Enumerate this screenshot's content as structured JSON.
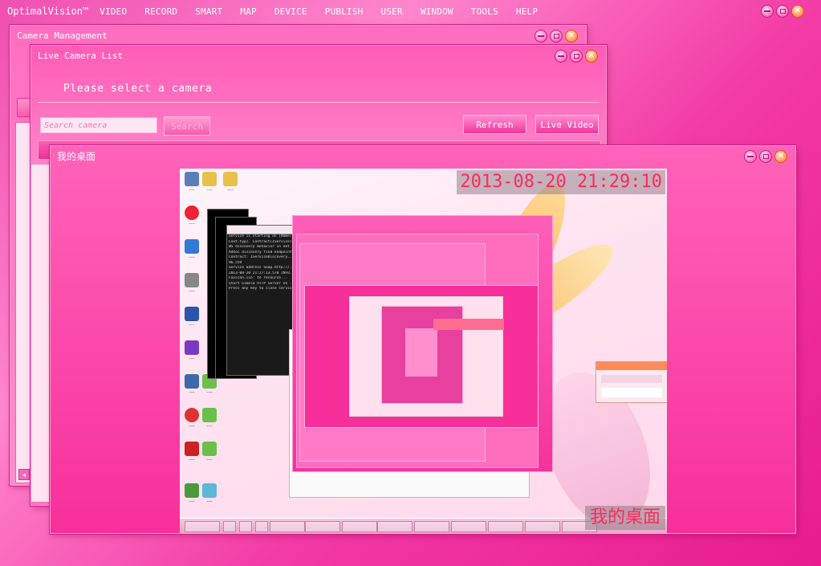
{
  "app": {
    "brand": "OptimalVision™",
    "menu": [
      "VIDEO",
      "RECORD",
      "SMART",
      "MAP",
      "DEVICE",
      "PUBLISH",
      "USER",
      "WINDOW",
      "TOOLS",
      "HELP"
    ]
  },
  "windows": {
    "camera_management": {
      "title": "Camera Management"
    },
    "live_camera_list": {
      "title": "Live Camera List",
      "prompt": "Please select a camera",
      "search_placeholder": "Search camera",
      "search_button": "Search",
      "refresh_button": "Refresh",
      "live_video_button": "Live Video"
    },
    "desktop_view": {
      "title": "我的桌面",
      "timestamp": "2013-08-20 21:29:10",
      "caption": "我的桌面"
    }
  },
  "icons": {
    "minimize": "minimize-icon",
    "maximize": "maximize-icon",
    "close": "close-icon"
  },
  "colors": {
    "theme": "#f23aa5",
    "accent": "#ff86cc",
    "close": "#ff9f5a",
    "timestamp_text": "#ff2a5e"
  }
}
